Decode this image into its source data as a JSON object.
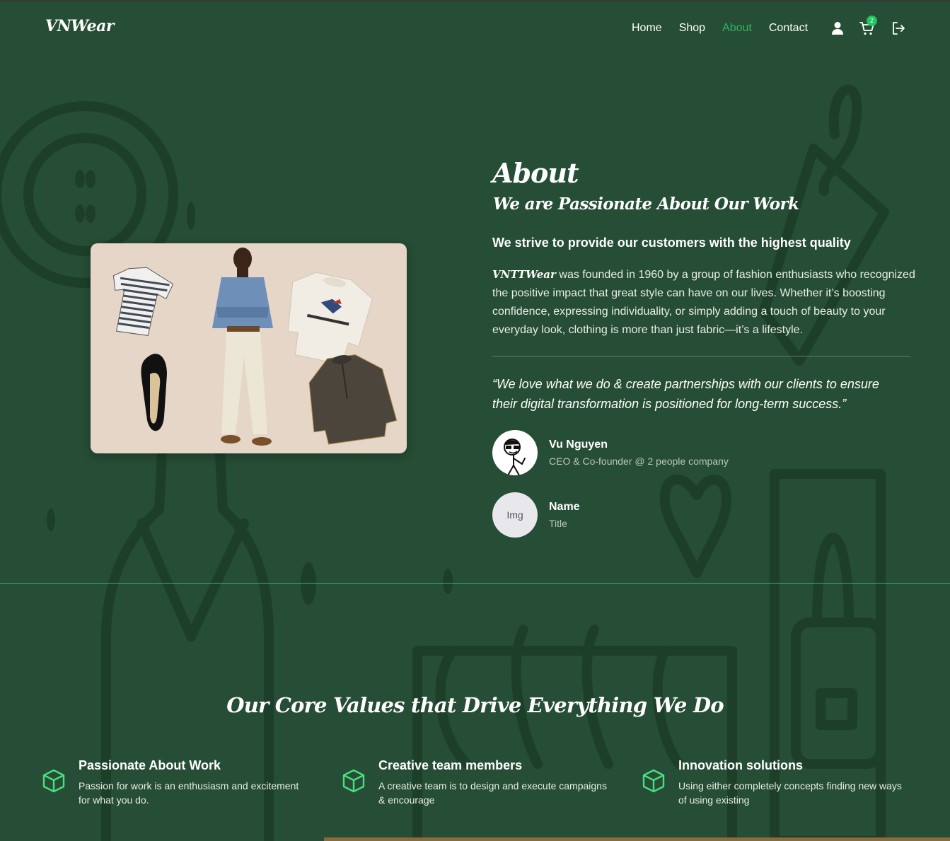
{
  "header": {
    "logo": "VNWear",
    "nav": [
      {
        "label": "Home",
        "active": false
      },
      {
        "label": "Shop",
        "active": false
      },
      {
        "label": "About",
        "active": true
      },
      {
        "label": "Contact",
        "active": false
      }
    ],
    "icons": [
      "user-icon",
      "cart-icon",
      "logout-icon"
    ],
    "cart_count": "2"
  },
  "about": {
    "title": "About",
    "subtitle": "We are Passionate About Our Work",
    "tagline": "We strive to provide our customers with the highest quality",
    "brand": "VNTTWear",
    "description": " was founded in 1960 by a group of fashion enthusiasts who recognized the positive impact that great style can have on our lives. Whether it’s boosting confidence, expressing individuality, or simply adding a touch of beauty to your everyday look, clothing is more than just fabric—it’s a lifestyle.",
    "quote": "“We love what we do & create partnerships with our clients to ensure their digital transformation is positioned for long-term success.”",
    "people": [
      {
        "name": "Vu Nguyen",
        "title": "CEO & Co-founder @ 2 people company",
        "avatar": "avatar-icon"
      },
      {
        "name": "Name",
        "title": "Title",
        "avatar": "Img"
      }
    ]
  },
  "values": {
    "title": "Our Core Values that Drive Everything We Do",
    "items": [
      {
        "title": "Passionate About Work",
        "description": "Passion for work is an enthusiasm and excitement for what you do.",
        "icon": "cube-icon"
      },
      {
        "title": "Creative team members",
        "description": "A creative team is to design and execute campaigns & encourage",
        "icon": "cube-icon"
      },
      {
        "title": "Innovation solutions",
        "description": "Using either completely concepts finding new ways of using existing",
        "icon": "cube-icon"
      }
    ]
  },
  "colors": {
    "background": "#264d35",
    "accent": "#2fb660",
    "badge": "#22c55e",
    "text": "#ffffff",
    "muted": "#b8c8bd"
  }
}
